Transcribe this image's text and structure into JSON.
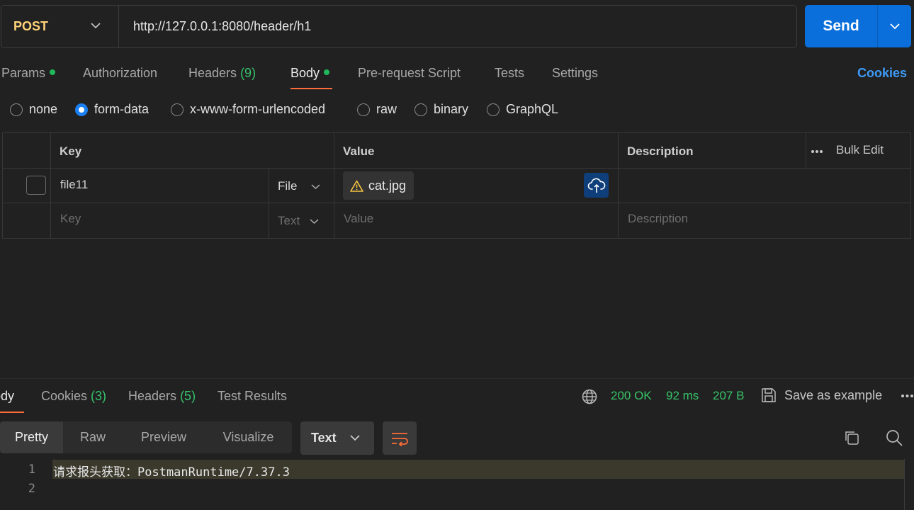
{
  "request": {
    "method": "POST",
    "url": "http://127.0.0.1:8080/header/h1",
    "send_label": "Send"
  },
  "tabs": {
    "params": "Params",
    "authorization": "Authorization",
    "headers": "Headers",
    "headers_count": "(9)",
    "body": "Body",
    "prerequest": "Pre-request Script",
    "tests": "Tests",
    "settings": "Settings",
    "cookies": "Cookies"
  },
  "body_types": {
    "none": "none",
    "form_data": "form-data",
    "urlencoded": "x-www-form-urlencoded",
    "raw": "raw",
    "binary": "binary",
    "graphql": "GraphQL",
    "selected": "form-data"
  },
  "table": {
    "headers": {
      "key": "Key",
      "value": "Value",
      "description": "Description",
      "bulk_edit": "Bulk Edit"
    },
    "rows": [
      {
        "key": "file11",
        "type": "File",
        "value": "cat.jpg",
        "description": ""
      }
    ],
    "empty_row": {
      "key": "Key",
      "type": "Text",
      "value": "Value",
      "description": "Description"
    }
  },
  "response": {
    "tabs": {
      "body": "Body",
      "cookies": "Cookies",
      "cookies_count": "(3)",
      "headers": "Headers",
      "headers_count": "(5)",
      "test_results": "Test Results"
    },
    "status": "200 OK",
    "time": "92 ms",
    "size": "207 B",
    "save_example": "Save as example",
    "views": {
      "pretty": "Pretty",
      "raw": "Raw",
      "preview": "Preview",
      "visualize": "Visualize"
    },
    "format": "Text",
    "lines": [
      {
        "num": "1",
        "text": "请求报头获取：PostmanRuntime/7.37.3"
      },
      {
        "num": "2",
        "text": ""
      }
    ]
  },
  "colors": {
    "accent_orange": "#ff6c37",
    "send_blue": "#0b6fdb",
    "method_yellow": "#ffd27a",
    "status_green": "#37c267"
  }
}
